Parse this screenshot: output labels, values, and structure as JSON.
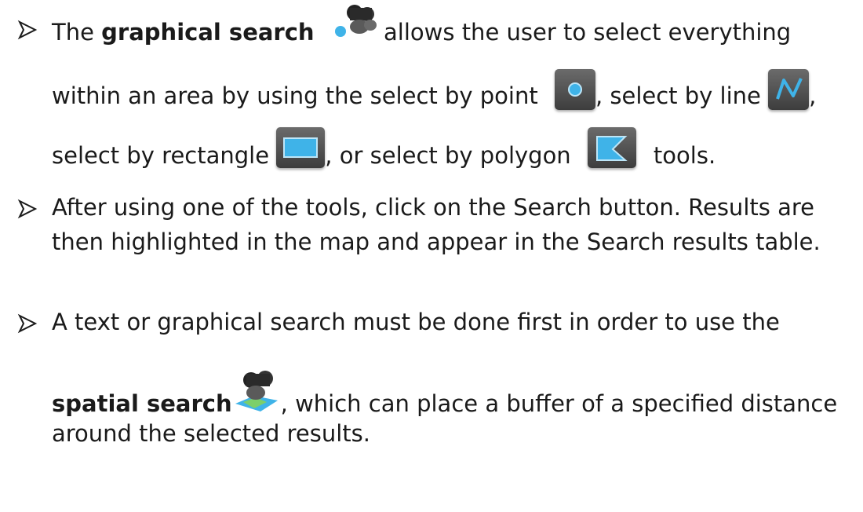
{
  "bullets": [
    {
      "line1_pre": "The ",
      "line1_bold": "graphical search",
      "line1_post": " allows the user to select everything",
      "line2_pre": "within an area by using the select by point",
      "line2_mid": ", select by line",
      "line2_post": ",",
      "line3_pre": "select by rectangle",
      "line3_mid": ", or select by polygon",
      "line3_post": "tools."
    },
    {
      "line1": "After using one of the tools, click on the Search button. Results are",
      "line2": "then highlighted in the map and appear in the Search results table."
    },
    {
      "line1": "A text or graphical search must be done first in order to use the",
      "line2_bold": "spatial search",
      "line2_post": ", which can place a buffer of a specified distance",
      "line3": "around the selected results."
    }
  ],
  "icons": {
    "graphical_search": "binoculars-point-icon",
    "select_point": "select-point-icon",
    "select_line": "select-line-icon",
    "select_rectangle": "select-rectangle-icon",
    "select_polygon": "select-polygon-icon",
    "spatial_search": "binoculars-map-icon"
  },
  "colors": {
    "tool_accent": "#3fb3e8",
    "tool_bg": "#4a4a4a"
  }
}
